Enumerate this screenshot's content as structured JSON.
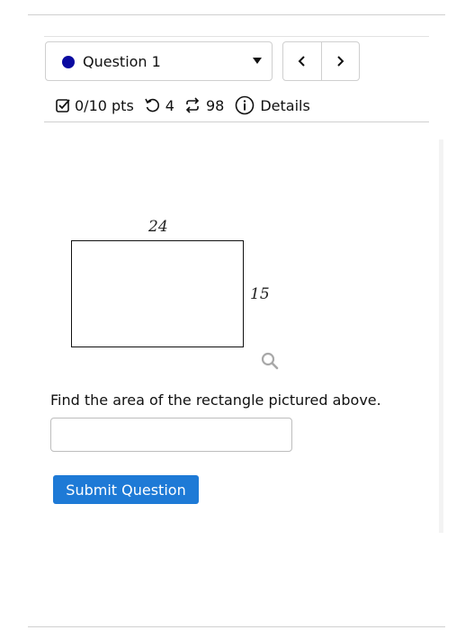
{
  "question_nav": {
    "selected_label": "Question 1",
    "status_color": "#0a0aa0",
    "prev_glyph": "‹",
    "next_glyph": "›"
  },
  "meta": {
    "score": "0/10 pts",
    "retries": "4",
    "attempts": "98",
    "details_label": "Details"
  },
  "figure": {
    "width_label": "24",
    "height_label": "15",
    "zoom_icon": "magnifier-icon"
  },
  "question": {
    "prompt": "Find the area of the rectangle pictured above.",
    "answer_value": "",
    "submit_label": "Submit Question"
  },
  "colors": {
    "submit_bg": "#1e7ad6",
    "border": "#cfcfcf"
  }
}
